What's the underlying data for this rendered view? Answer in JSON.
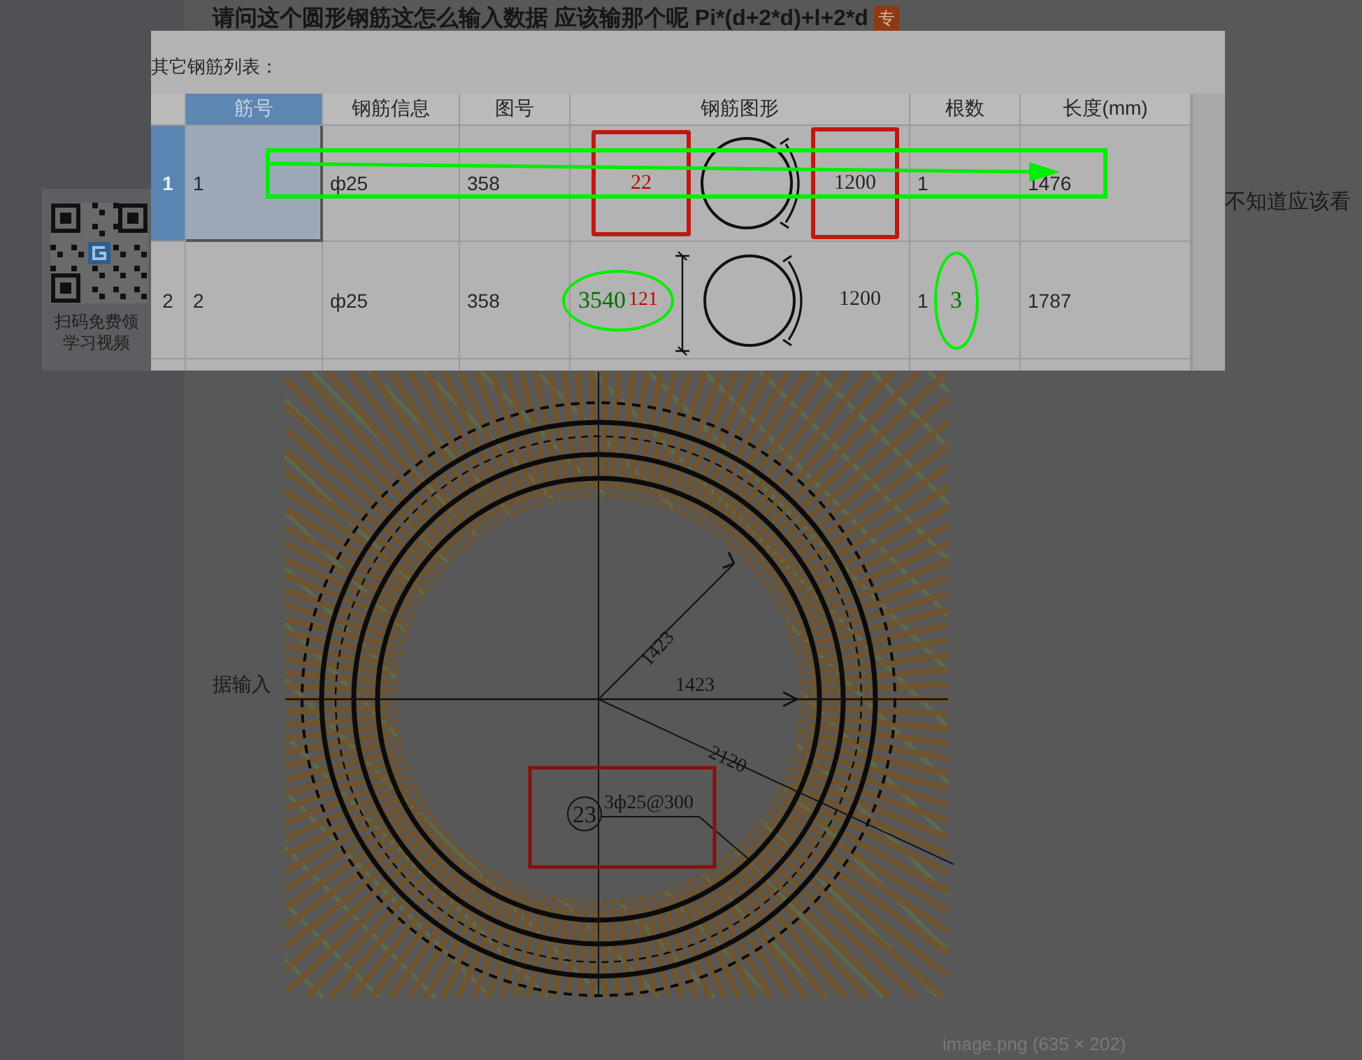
{
  "post": {
    "title": "请问这个圆形钢筋这怎么输入数据 应该输那个呢 Pi*(d+2*d)+l+2*d",
    "badge": "专",
    "text_right": "不知道应该看",
    "text_left": "据输入"
  },
  "qr_card": {
    "caption_lines": [
      "扫码免费领",
      "学习视频"
    ]
  },
  "lightbox": {
    "heading": "其它钢筋列表：",
    "columns": [
      {
        "label": "筋号",
        "selected": true
      },
      {
        "label": "钢筋信息",
        "selected": false
      },
      {
        "label": "图号",
        "selected": false
      },
      {
        "label": "钢筋图形",
        "selected": false
      },
      {
        "label": "根数",
        "selected": false
      },
      {
        "label": "长度(mm)",
        "selected": false
      }
    ],
    "rows": [
      {
        "selected": true,
        "number": "1",
        "bar_no": "1",
        "info": "ф25",
        "figure_no": "358",
        "shape": {
          "kind": "boxed",
          "left_label": "22",
          "right_label": "1200"
        },
        "arrow_annotation": true,
        "count": "1",
        "length": "1476"
      },
      {
        "selected": false,
        "number": "2",
        "bar_no": "2",
        "info": "ф25",
        "figure_no": "358",
        "shape": {
          "kind": "dimensioned",
          "left_label": "121",
          "left_note": "3540",
          "right_label": "1200"
        },
        "arrow_annotation": false,
        "count": "1",
        "count_note": "3",
        "length": "1787"
      }
    ],
    "caption": "image.png (635 × 202)"
  },
  "drawing": {
    "labels": [
      "1423",
      "1423",
      "2120"
    ],
    "callout_number": "23",
    "callout_text": "3ф25@300"
  }
}
